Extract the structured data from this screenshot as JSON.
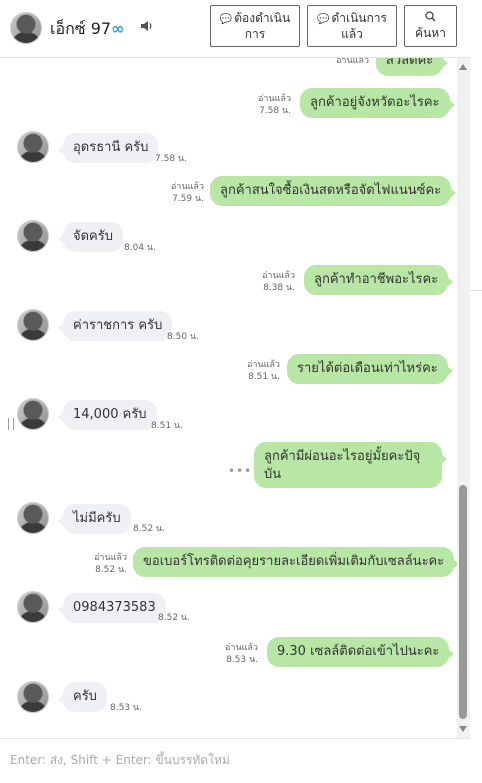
{
  "header": {
    "contact_name": "เอ็กซ์ 97",
    "contact_name_suffix": "∞",
    "buttons": {
      "todo": "ต้องดำเนินการ",
      "todo_line1": "ต้องดำเนิน",
      "todo_line2": "การ",
      "done_line1": "ดำเนินการ",
      "done_line2": "แล้ว",
      "search_label": "ค้นหา"
    }
  },
  "messages": [
    {
      "side": "out",
      "text": "สวัสดีค่ะ",
      "status": "อ่านแล้ว",
      "time": ""
    },
    {
      "side": "out",
      "text": "ลูกค้าอยู่จังหวัดอะไรคะ",
      "status": "อ่านแล้ว",
      "time": "7.58 น."
    },
    {
      "side": "in",
      "text": "อุดรธานี ครับ",
      "time": "7.58 น."
    },
    {
      "side": "out",
      "text": "ลูกค้าสนใจซื้อเงินสดหรือจัดไฟแนนซ์คะ",
      "status": "อ่านแล้ว",
      "time": "7.59 น."
    },
    {
      "side": "in",
      "text": "จัดครับ",
      "time": "8.04 น."
    },
    {
      "side": "out",
      "text": "ลูกค้าทำอาชีพอะไรคะ",
      "status": "อ่านแล้ว",
      "time": "8.38 น."
    },
    {
      "side": "in",
      "text": "ค่าราชการ ครับ",
      "time": "8.50 น."
    },
    {
      "side": "out",
      "text": "รายได้ต่อเดือนเท่าไหร่คะ",
      "status": "อ่านแล้ว",
      "time": "8.51 น."
    },
    {
      "side": "in",
      "text": "14,000 ครับ",
      "time": "8.51 น."
    },
    {
      "side": "out",
      "text": "ลูกค้ามีผ่อนอะไรอยู่มั้ยคะปัจุบัน",
      "status": "",
      "time": "",
      "typing": "•••"
    },
    {
      "side": "in",
      "text": "ไม่มีครับ",
      "time": "8.52 น."
    },
    {
      "side": "out",
      "text": "ขอเบอร์โทรติดต่อคุยรายละเอียดเพิ่มเติมกับเซลล์นะคะ",
      "status": "อ่านแล้ว",
      "time": "8.52 น."
    },
    {
      "side": "in",
      "text": "0984373583",
      "time": "8.52 น."
    },
    {
      "side": "out",
      "text": "9.30 เซลล์ติดต่อเข้าไปนะคะ",
      "status": "อ่านแล้ว",
      "time": "8.53 น."
    },
    {
      "side": "in",
      "text": "ครับ",
      "time": "8.53 น."
    }
  ],
  "input": {
    "placeholder": "Enter: ส่ง, Shift + Enter: ขึ้นบรรทัดใหม่",
    "value": ""
  },
  "colors": {
    "outgoing_bubble": "#b8e6a4",
    "incoming_bubble": "#eef0f3",
    "accent": "#29a3d8"
  }
}
